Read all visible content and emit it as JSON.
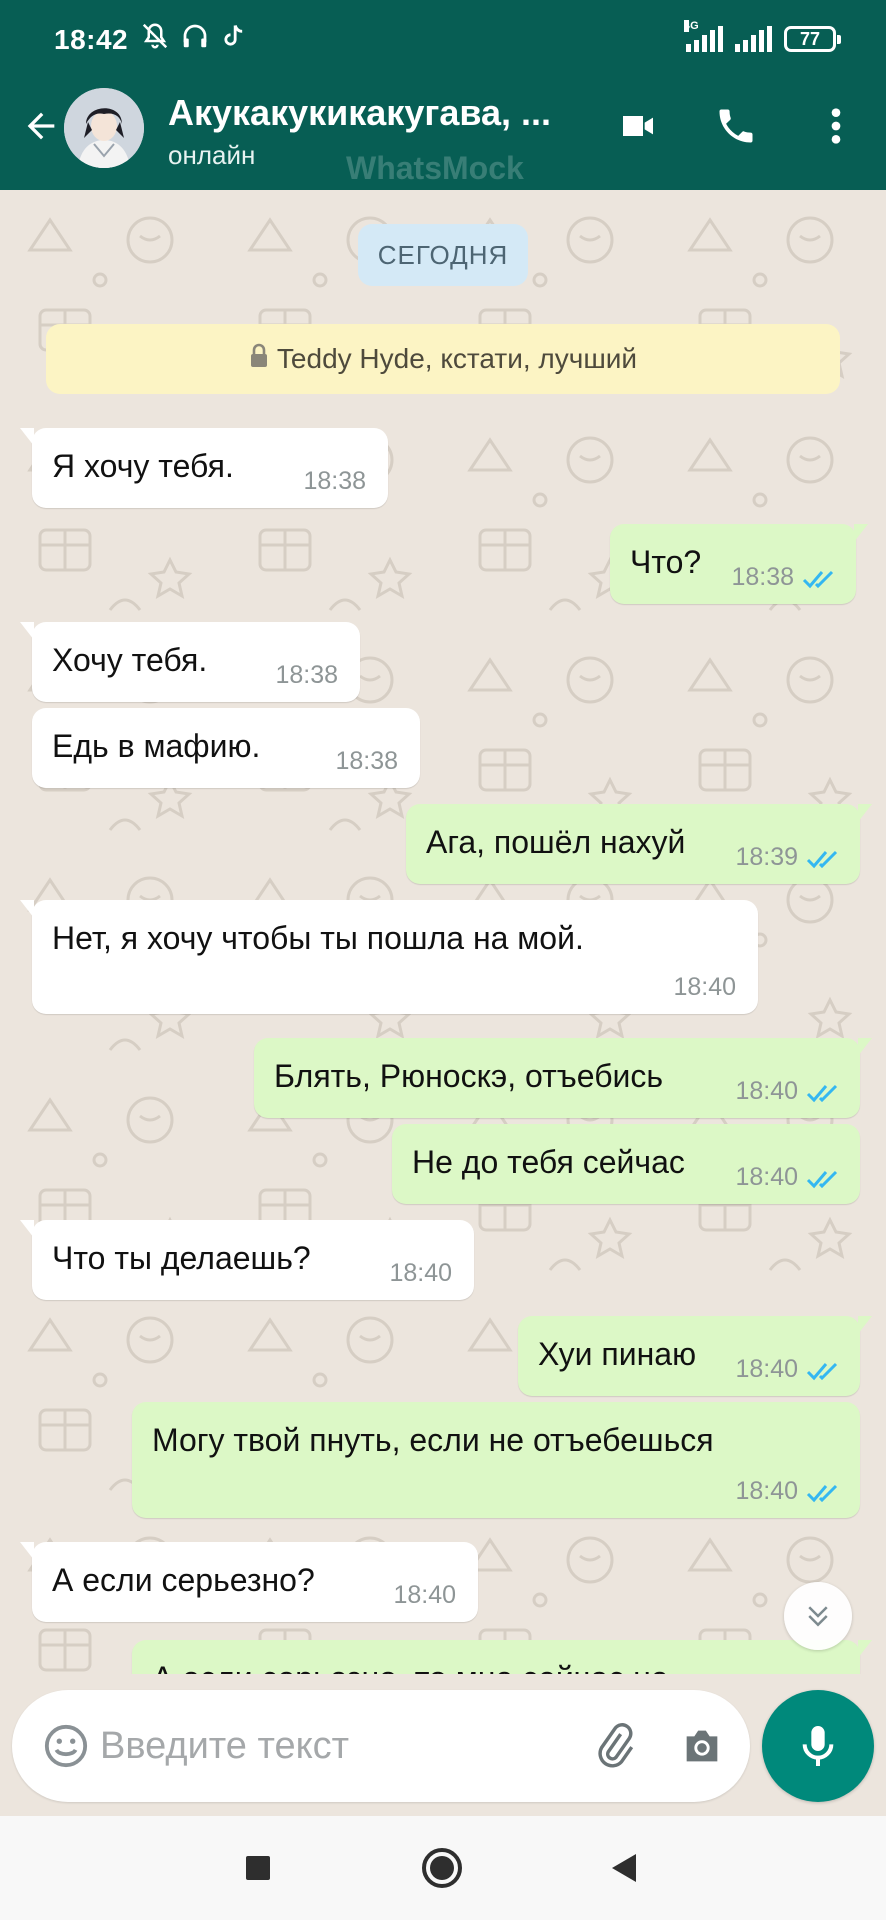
{
  "status_bar": {
    "time": "18:42",
    "network_tag": "4G",
    "battery": "77",
    "icons": [
      "mute-icon",
      "headphones-icon",
      "tiktok-icon",
      "signal-icon",
      "battery-icon"
    ]
  },
  "header": {
    "contact_name": "Акукакукикакугава, ...",
    "contact_status": "онлайн",
    "watermark": "WhatsMock",
    "icons": [
      "back-arrow-icon",
      "video-call-icon",
      "phone-icon",
      "more-vert-icon"
    ]
  },
  "chat": {
    "date_label": "СЕГОДНЯ",
    "notice": "Teddy Hyde, кстати, лучший",
    "messages": [
      {
        "dir": "in",
        "text": "Я хочу тебя.",
        "time": "18:38"
      },
      {
        "dir": "out",
        "text": "Что?",
        "time": "18:38",
        "read": true
      },
      {
        "dir": "in",
        "text": "Хочу тебя.",
        "time": "18:38"
      },
      {
        "dir": "in",
        "text": "Едь в мафию.",
        "time": "18:38"
      },
      {
        "dir": "out",
        "text": "Ага, пошёл нахуй",
        "time": "18:39",
        "read": true
      },
      {
        "dir": "in",
        "text": "Нет, я хочу чтобы ты пошла на мой.",
        "time": "18:40"
      },
      {
        "dir": "out",
        "text": "Блять, Рюноскэ, отъебись",
        "time": "18:40",
        "read": true
      },
      {
        "dir": "out",
        "text": "Не до тебя сейчас",
        "time": "18:40",
        "read": true
      },
      {
        "dir": "in",
        "text": "Что ты делаешь?",
        "time": "18:40"
      },
      {
        "dir": "out",
        "text": "Хуи пинаю",
        "time": "18:40",
        "read": true
      },
      {
        "dir": "out",
        "text": "Могу твой пнуть, если не отъебешься",
        "time": "18:40",
        "read": true
      },
      {
        "dir": "in",
        "text": "А если серьезно?",
        "time": "18:40"
      },
      {
        "dir": "out",
        "text": "А если серьезно, то мне сейчас не",
        "time": "",
        "read": true
      }
    ]
  },
  "input": {
    "placeholder": "Введите текст",
    "value": ""
  },
  "colors": {
    "header": "#075e54",
    "chat_bg": "#ece5dd",
    "bubble_out": "#dcf8c6",
    "bubble_in": "#ffffff",
    "read_ticks": "#34b7f1",
    "mic": "#00897b",
    "date_chip": "#d4e9f6",
    "notice": "#fcf4c4"
  }
}
